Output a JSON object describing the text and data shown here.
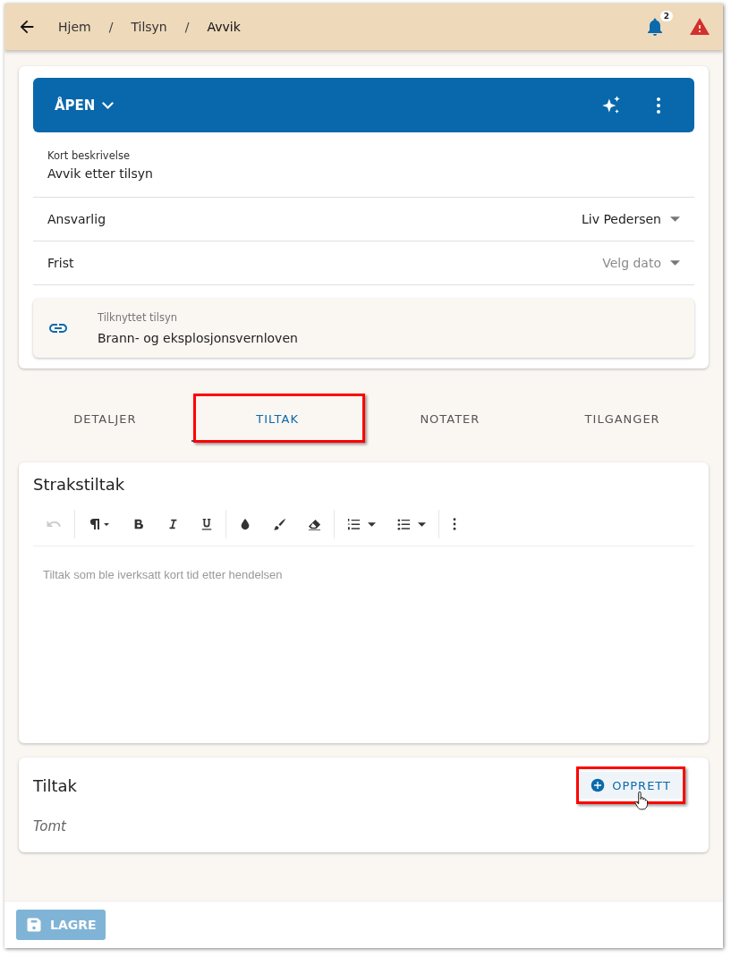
{
  "breadcrumbs": [
    "Hjem",
    "Tilsyn",
    "Avvik"
  ],
  "breadcrumb_separator": "/",
  "notifications": {
    "count": "2"
  },
  "status": {
    "label": "ÅPEN"
  },
  "description": {
    "label": "Kort beskrivelse",
    "value": "Avvik etter tilsyn"
  },
  "fields": [
    {
      "label": "Ansvarlig",
      "value": "Liv Pedersen"
    },
    {
      "label": "Frist",
      "placeholder": "Velg dato"
    }
  ],
  "linked": {
    "label": "Tilknyttet tilsyn",
    "value": "Brann- og eksplosjonsvernloven"
  },
  "tabs": [
    {
      "label": "DETALJER",
      "selected": false,
      "highlighted": false
    },
    {
      "label": "TILTAK",
      "selected": true,
      "highlighted": true
    },
    {
      "label": "NOTATER",
      "selected": false,
      "highlighted": false
    },
    {
      "label": "TILGANGER",
      "selected": false,
      "highlighted": false
    }
  ],
  "editor": {
    "title": "Strakstiltak",
    "undo_disabled": true,
    "placeholder": "Tiltak som ble iverksatt kort tid etter hendelsen"
  },
  "measures": {
    "title": "Tiltak",
    "create_button": {
      "label": "OPPRETT",
      "highlighted": true
    },
    "empty_text": "Tomt"
  },
  "save_button": {
    "label": "LAGRE",
    "disabled": true
  }
}
